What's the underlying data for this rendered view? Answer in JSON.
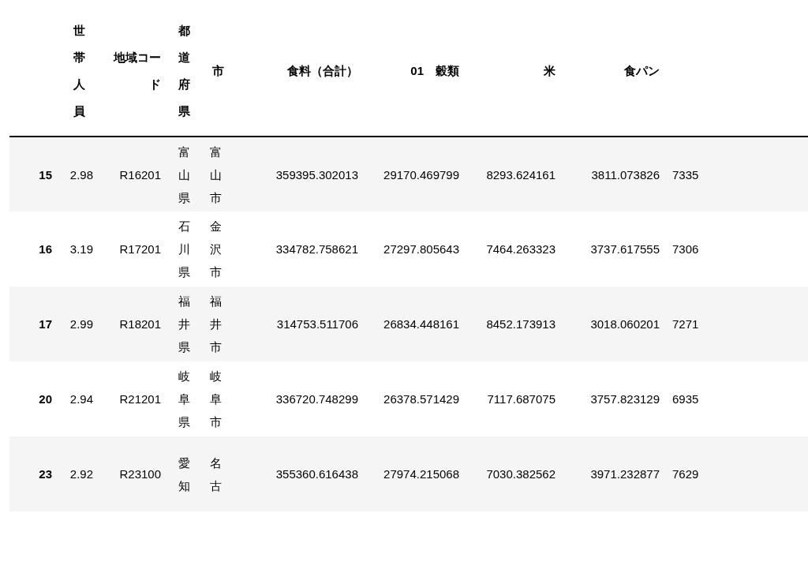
{
  "table": {
    "columns": [
      "世帯人員",
      "地域コード",
      "都道府県",
      "市",
      "食料（合計）",
      "01　穀類",
      "米",
      "食パン"
    ],
    "rows": [
      {
        "index": "15",
        "cells": [
          "2.98",
          "R16201",
          "富山県",
          "富山市",
          "359395.302013",
          "29170.469799",
          "8293.624161",
          "3811.073826",
          "7335"
        ]
      },
      {
        "index": "16",
        "cells": [
          "3.19",
          "R17201",
          "石川県",
          "金沢市",
          "334782.758621",
          "27297.805643",
          "7464.263323",
          "3737.617555",
          "7306"
        ]
      },
      {
        "index": "17",
        "cells": [
          "2.99",
          "R18201",
          "福井県",
          "福井市",
          "314753.511706",
          "26834.448161",
          "8452.173913",
          "3018.060201",
          "7271"
        ]
      },
      {
        "index": "20",
        "cells": [
          "2.94",
          "R21201",
          "岐阜県",
          "岐阜市",
          "336720.748299",
          "26378.571429",
          "7117.687075",
          "3757.823129",
          "6935"
        ]
      },
      {
        "index": "23",
        "cells": [
          "2.92",
          "R23100",
          "愛知",
          "名古",
          "355360.616438",
          "27974.215068",
          "7030.382562",
          "3971.232877",
          "7629"
        ]
      }
    ]
  }
}
